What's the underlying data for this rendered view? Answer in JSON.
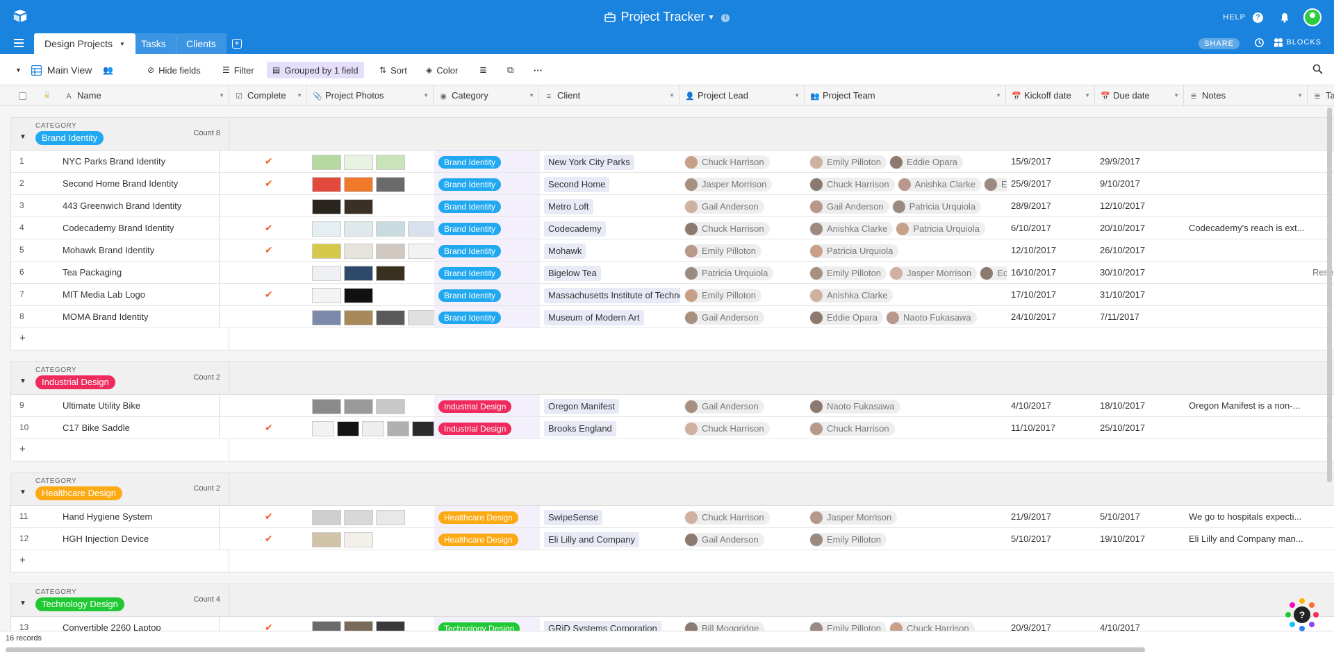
{
  "app": {
    "title": "Project Tracker",
    "help_label": "HELP",
    "share_label": "SHARE",
    "blocks_label": "BLOCKS"
  },
  "tabs": [
    {
      "label": "Design Projects",
      "active": true
    },
    {
      "label": "Tasks",
      "active": false
    },
    {
      "label": "Clients",
      "active": false
    }
  ],
  "toolbar": {
    "view_name": "Main View",
    "hide_fields": "Hide fields",
    "filter": "Filter",
    "grouped": "Grouped by 1 field",
    "sort": "Sort",
    "color": "Color"
  },
  "columns": [
    {
      "label": "Name",
      "icon": "text-icon"
    },
    {
      "label": "Complete",
      "icon": "checkbox-icon"
    },
    {
      "label": "Project Photos",
      "icon": "attachment-icon"
    },
    {
      "label": "Category",
      "icon": "select-icon"
    },
    {
      "label": "Client",
      "icon": "link-icon"
    },
    {
      "label": "Project Lead",
      "icon": "user-icon"
    },
    {
      "label": "Project Team",
      "icon": "users-icon"
    },
    {
      "label": "Kickoff date",
      "icon": "calendar-icon"
    },
    {
      "label": "Due date",
      "icon": "calendar-icon"
    },
    {
      "label": "Notes",
      "icon": "notes-icon"
    },
    {
      "label": "Ta",
      "icon": "notes-icon"
    }
  ],
  "group_label": "CATEGORY",
  "count_label": "Count",
  "groups": [
    {
      "name": "Brand Identity",
      "color": "#20a8f0",
      "count": "Count 8",
      "rows": [
        {
          "n": "1",
          "name": "NYC Parks Brand Identity",
          "done": true,
          "photos": [
            "#b5d9a0",
            "#e8f3e4",
            "#c9e4b8"
          ],
          "client": "New York City Parks",
          "lead": "Chuck Harrison",
          "team": [
            "Emily Pilloton",
            "Eddie Opara"
          ],
          "kickoff": "15/9/2017",
          "due": "29/9/2017",
          "notes": ""
        },
        {
          "n": "2",
          "name": "Second Home Brand Identity",
          "done": true,
          "photos": [
            "#e24a3c",
            "#f07a2a",
            "#6a6a6a"
          ],
          "client": "Second Home",
          "lead": "Jasper Morrison",
          "team": [
            "Chuck Harrison",
            "Anishka Clarke",
            "Ec"
          ],
          "kickoff": "25/9/2017",
          "due": "9/10/2017",
          "notes": ""
        },
        {
          "n": "3",
          "name": "443 Greenwich Brand Identity",
          "done": false,
          "photos": [
            "#2a241e",
            "#3a3026"
          ],
          "client": "Metro Loft",
          "lead": "Gail Anderson",
          "team": [
            "Gail Anderson",
            "Patricia Urquiola"
          ],
          "kickoff": "28/9/2017",
          "due": "12/10/2017",
          "notes": ""
        },
        {
          "n": "4",
          "name": "Codecademy Brand Identity",
          "done": true,
          "photos": [
            "#e5eef3",
            "#dfe8ea",
            "#c8dcdf",
            "#d9e1ee"
          ],
          "client": "Codecademy",
          "lead": "Chuck Harrison",
          "team": [
            "Anishka Clarke",
            "Patricia Urquiola"
          ],
          "kickoff": "6/10/2017",
          "due": "20/10/2017",
          "notes": "Codecademy's reach is ext..."
        },
        {
          "n": "5",
          "name": "Mohawk Brand Identity",
          "done": true,
          "photos": [
            "#d4c94a",
            "#e6e2dc",
            "#cfc7c0",
            "#f2f2f2"
          ],
          "client": "Mohawk",
          "lead": "Emily Pilloton",
          "team": [
            "Patricia Urquiola"
          ],
          "kickoff": "12/10/2017",
          "due": "26/10/2017",
          "notes": ""
        },
        {
          "n": "6",
          "name": "Tea Packaging",
          "done": false,
          "photos": [
            "#eef0f3",
            "#2d4a6a",
            "#3a3020"
          ],
          "client": "Bigelow Tea",
          "lead": "Patricia Urquiola",
          "team": [
            "Emily Pilloton",
            "Jasper Morrison",
            "Ec"
          ],
          "kickoff": "16/10/2017",
          "due": "30/10/2017",
          "notes": "",
          "extra": "Rese"
        },
        {
          "n": "7",
          "name": "MIT Media Lab Logo",
          "done": true,
          "photos": [
            "#f4f4f4",
            "#111111"
          ],
          "client": "Massachusetts Institute of Technology",
          "lead": "Emily Pilloton",
          "team": [
            "Anishka Clarke"
          ],
          "kickoff": "17/10/2017",
          "due": "31/10/2017",
          "notes": ""
        },
        {
          "n": "8",
          "name": "MOMA Brand Identity",
          "done": false,
          "photos": [
            "#7a8aa8",
            "#a88a5a",
            "#5a5a5a",
            "#e0e0e0"
          ],
          "client": "Museum of Modern Art",
          "lead": "Gail Anderson",
          "team": [
            "Eddie Opara",
            "Naoto Fukasawa"
          ],
          "kickoff": "24/10/2017",
          "due": "7/11/2017",
          "notes": ""
        }
      ]
    },
    {
      "name": "Industrial Design",
      "color": "#ee2b5c",
      "count": "Count 2",
      "rows": [
        {
          "n": "9",
          "name": "Ultimate Utility Bike",
          "done": false,
          "photos": [
            "#8a8a8a",
            "#9a9a9a",
            "#c8c8c8"
          ],
          "client": "Oregon Manifest",
          "lead": "Gail Anderson",
          "team": [
            "Naoto Fukasawa"
          ],
          "kickoff": "4/10/2017",
          "due": "18/10/2017",
          "notes": "Oregon Manifest is a non-..."
        },
        {
          "n": "10",
          "name": "C17 Bike Saddle",
          "done": true,
          "photos": [
            "#f2f2f2",
            "#141414",
            "#eeeeee",
            "#b0b0b0",
            "#2a2a2a"
          ],
          "client": "Brooks England",
          "lead": "Chuck Harrison",
          "team": [
            "Chuck Harrison"
          ],
          "kickoff": "11/10/2017",
          "due": "25/10/2017",
          "notes": ""
        }
      ]
    },
    {
      "name": "Healthcare Design",
      "color": "#fcaa14",
      "count": "Count 2",
      "rows": [
        {
          "n": "11",
          "name": "Hand Hygiene System",
          "done": true,
          "photos": [
            "#cfcfcf",
            "#d8d8d8",
            "#e8e8e8"
          ],
          "client": "SwipeSense",
          "lead": "Chuck Harrison",
          "team": [
            "Jasper Morrison"
          ],
          "kickoff": "21/9/2017",
          "due": "5/10/2017",
          "notes": "We go to hospitals expecti..."
        },
        {
          "n": "12",
          "name": "HGH Injection Device",
          "done": true,
          "photos": [
            "#cfc4a8",
            "#f2f0e8"
          ],
          "client": "Eli Lilly and Company",
          "lead": "Gail Anderson",
          "team": [
            "Emily Pilloton"
          ],
          "kickoff": "5/10/2017",
          "due": "19/10/2017",
          "notes": "Eli Lilly and Company man..."
        }
      ]
    },
    {
      "name": "Technology Design",
      "color": "#20c933",
      "count": "Count 4",
      "rows": [
        {
          "n": "13",
          "name": "Convertible 2260 Laptop",
          "done": true,
          "photos": [
            "#6a6a6a",
            "#7a6a5a",
            "#3a3a3a"
          ],
          "client": "GRiD Systems Corporation",
          "lead": "Bill Moggridge",
          "team": [
            "Emily Pilloton",
            "Chuck Harrison"
          ],
          "kickoff": "20/9/2017",
          "due": "4/10/2017",
          "notes": ""
        }
      ]
    }
  ],
  "footer": {
    "records": "16 records"
  },
  "colors": {
    "topbar": "#1a83dd",
    "check": "#f0632a",
    "grouped_bg": "#e6dffc"
  }
}
